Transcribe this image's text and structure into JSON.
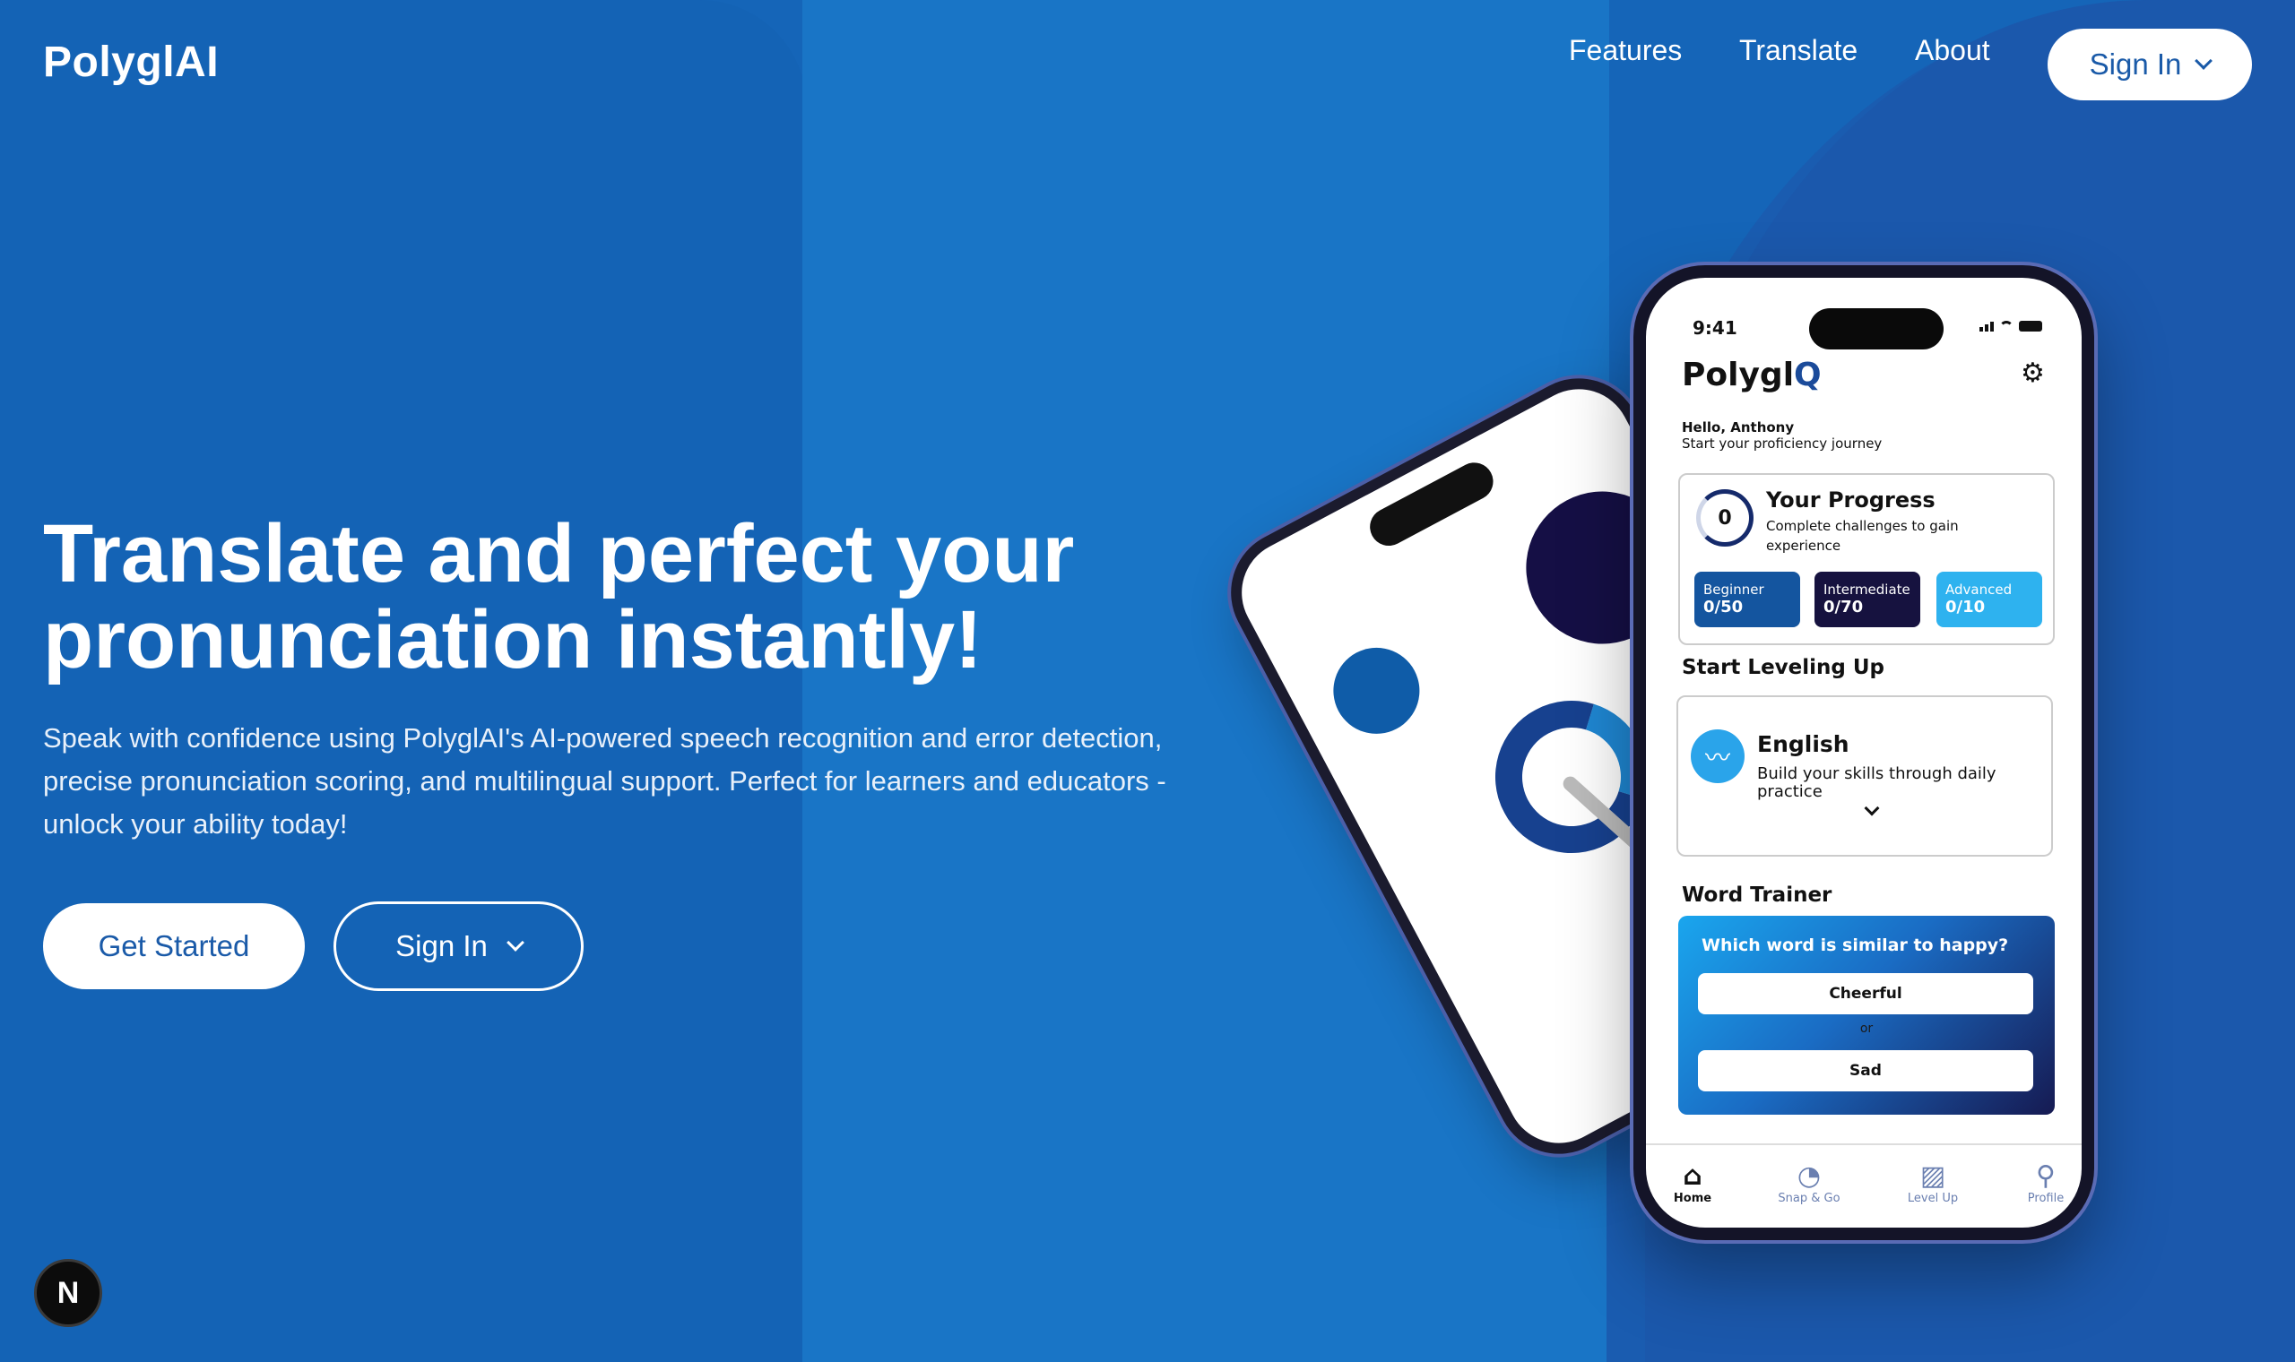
{
  "header": {
    "logo": "PolyglAI",
    "nav": [
      "Features",
      "Translate",
      "About"
    ],
    "signin": "Sign In"
  },
  "hero": {
    "title": "Translate and perfect your pronunciation instantly!",
    "description": "Speak with confidence using PolyglAI's AI-powered speech recognition and error detection, precise pronunciation scoring, and multilingual support. Perfect for learners and educators - unlock your ability today!",
    "get_started": "Get Started",
    "signin": "Sign In"
  },
  "badge": "N",
  "phone": {
    "time": "9:41",
    "app_logo_text": "Polygl",
    "app_logo_mark": "Q",
    "greeting": "Hello, Anthony",
    "greeting_sub": "Start your proficiency journey",
    "progress": {
      "count": "0",
      "title": "Your Progress",
      "subtitle": "Complete challenges to gain experience",
      "levels": [
        {
          "label": "Beginner",
          "value": "0/50"
        },
        {
          "label": "Intermediate",
          "value": "0/70"
        },
        {
          "label": "Advanced",
          "value": "0/10"
        }
      ]
    },
    "leveling": {
      "heading": "Start Leveling Up",
      "language": "English",
      "description": "Build your skills through daily practice"
    },
    "word_trainer": {
      "heading": "Word Trainer",
      "question": "Which word is similar to happy?",
      "option1": "Cheerful",
      "or": "or",
      "option2": "Sad"
    },
    "tabs": [
      {
        "label": "Home",
        "icon": "home-icon"
      },
      {
        "label": "Snap & Go",
        "icon": "snap-icon"
      },
      {
        "label": "Level Up",
        "icon": "chart-icon"
      },
      {
        "label": "Profile",
        "icon": "profile-icon"
      }
    ]
  },
  "colors": {
    "primary": "#1565b8",
    "brand_dark": "#16123f",
    "accent": "#2eb2ef"
  }
}
